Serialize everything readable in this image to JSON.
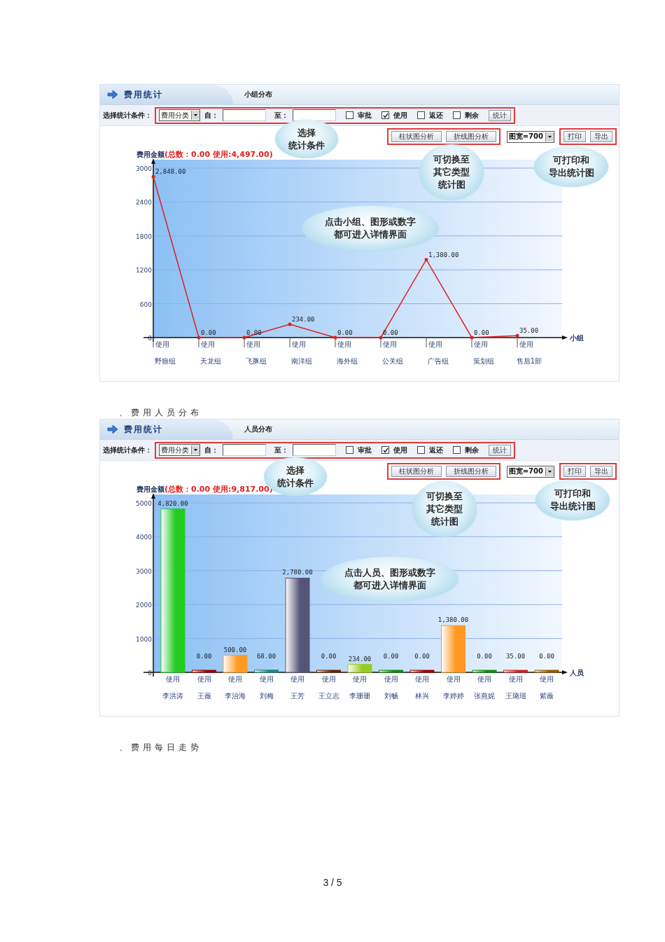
{
  "blocks": [
    {
      "kind": "panel",
      "title": "费用统计",
      "tab": "小组分布",
      "toolbar": {
        "label": "选择统计条件：",
        "category_select": "费用分类",
        "from_label": "自：",
        "to_label": "至：",
        "checkboxes": [
          {
            "label": "审批",
            "checked": false
          },
          {
            "label": "使用",
            "checked": true
          },
          {
            "label": "返还",
            "checked": false
          },
          {
            "label": "剩余",
            "checked": false
          }
        ],
        "submit": "统计"
      },
      "chart_buttons": [
        "柱状图分析",
        "折线图分析"
      ],
      "width_select": "图宽=700",
      "action_buttons": [
        "打印",
        "导出"
      ],
      "summary": "(总数：0.00 使用:4,497.00)",
      "callouts": [
        {
          "kind": "conditions",
          "lines": [
            "选择",
            "统计条件"
          ]
        },
        {
          "kind": "switch",
          "lines": [
            "可切换至",
            "其它类型",
            "统计图"
          ]
        },
        {
          "kind": "export",
          "lines": [
            "可打印和",
            "导出统计图"
          ]
        },
        {
          "kind": "detail",
          "lines": [
            "点击小组、图形或数字",
            "都可进入详情界面"
          ]
        }
      ],
      "chart_data": {
        "type": "line",
        "ylabel": "费用金额",
        "xlabel": "小组",
        "categories": [
          "野狼组",
          "天龙组",
          "飞豚组",
          "南洋组",
          "海外组",
          "公关组",
          "广告组",
          "策划组",
          "售后1部"
        ],
        "series": [
          {
            "name": "使用",
            "color": "#e02020",
            "values": [
              2848,
              0,
              0,
              234,
              0,
              0,
              1380,
              0,
              35
            ]
          }
        ],
        "grid": true,
        "ylim": [
          0,
          3000
        ],
        "yticks": [
          0,
          600,
          1200,
          1800,
          2400,
          3000
        ],
        "value_labels": [
          "2,848.00",
          "0.00",
          "0.00",
          "234.00",
          "0.00",
          "0.00",
          "1,380.00",
          "0.00",
          "35.00"
        ]
      }
    },
    {
      "kind": "caption",
      "text": "、费用人员分布"
    },
    {
      "kind": "panel",
      "title": "费用统计",
      "tab": "人员分布",
      "toolbar": {
        "label": "选择统计条件：",
        "category_select": "费用分类",
        "from_label": "自：",
        "to_label": "至：",
        "checkboxes": [
          {
            "label": "审批",
            "checked": false
          },
          {
            "label": "使用",
            "checked": true
          },
          {
            "label": "返还",
            "checked": false
          },
          {
            "label": "剩余",
            "checked": false
          }
        ],
        "submit": "统计"
      },
      "chart_buttons": [
        "柱状图分析",
        "折线图分析"
      ],
      "width_select": "图宽=700",
      "action_buttons": [
        "打印",
        "导出"
      ],
      "summary": "(总数：0.00 使用:9,817.00)",
      "callouts": [
        {
          "kind": "conditions",
          "lines": [
            "选择",
            "统计条件"
          ]
        },
        {
          "kind": "switch",
          "lines": [
            "可切换至",
            "其它类型",
            "统计图"
          ]
        },
        {
          "kind": "export",
          "lines": [
            "可打印和",
            "导出统计图"
          ]
        },
        {
          "kind": "detail",
          "lines": [
            "点击人员、图形或数字",
            "都可进入详情界面"
          ]
        }
      ],
      "chart_data": {
        "type": "bar",
        "ylabel": "费用金额",
        "xlabel": "人员",
        "categories": [
          "李洪涛",
          "王薇",
          "李治海",
          "刘梅",
          "王芳",
          "王立志",
          "李珊珊",
          "刘畅",
          "林兴",
          "李婷婷",
          "张燕妮",
          "王璐瑶",
          "紫薇"
        ],
        "series": [
          {
            "name": "使用",
            "values": [
              4820,
              0,
              500,
              68,
              2780,
              0,
              234,
              0,
              0,
              1380,
              0,
              35,
              0
            ]
          }
        ],
        "grid": true,
        "ylim": [
          0,
          5000
        ],
        "yticks": [
          0,
          1000,
          2000,
          3000,
          4000,
          5000
        ],
        "value_labels": [
          "4,820.00",
          "0.00",
          "500.00",
          "68.00",
          "2,780.00",
          "0.00",
          "234.00",
          "0.00",
          "0.00",
          "1,380.00",
          "0.00",
          "35.00",
          "0.00"
        ]
      }
    },
    {
      "kind": "caption",
      "text": "、费用每日走势"
    }
  ],
  "page_number": "3 / 5"
}
